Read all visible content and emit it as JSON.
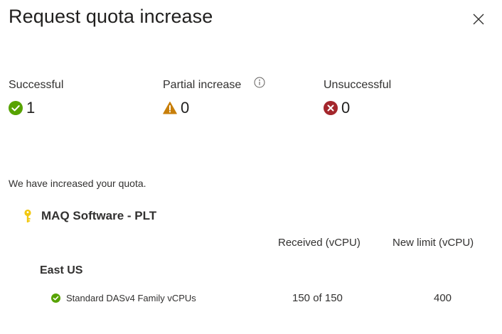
{
  "panel": {
    "title": "Request quota increase",
    "close_icon": "close-icon"
  },
  "summary": {
    "successful": {
      "label": "Successful",
      "count": "1",
      "icon": "check-circle-icon",
      "color": "#57a300"
    },
    "partial": {
      "label": "Partial increase",
      "count": "0",
      "icon": "warning-icon",
      "info_icon": "info-icon",
      "color": "#c87f0a"
    },
    "unsuccessful": {
      "label": "Unsuccessful",
      "count": "0",
      "icon": "error-circle-icon",
      "color": "#a4262c"
    }
  },
  "message": "We have increased your quota.",
  "subscription": {
    "icon": "key-icon",
    "name": "MAQ Software - PLT"
  },
  "table": {
    "columns": [
      "Received (vCPU)",
      "New limit (vCPU)"
    ],
    "regions": [
      {
        "name": "East US",
        "rows": [
          {
            "icon": "check-circle-icon",
            "name": "Standard DASv4 Family vCPUs",
            "received": "150 of 150",
            "new_limit": "400"
          }
        ]
      }
    ]
  }
}
